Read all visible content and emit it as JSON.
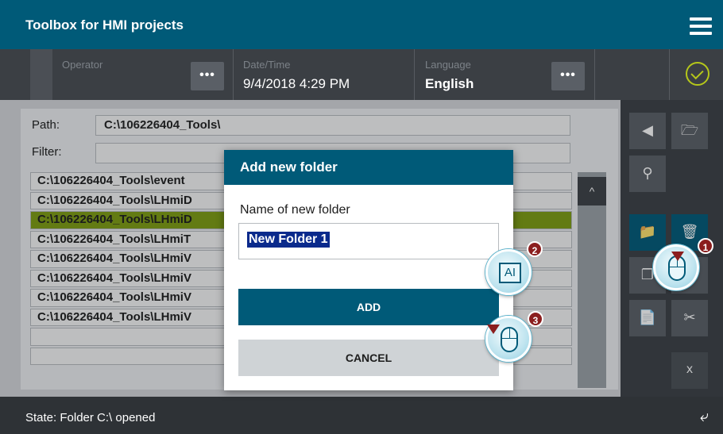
{
  "app": {
    "title": "Toolbox for HMI projects"
  },
  "infobar": {
    "operator_label": "Operator",
    "datetime_label": "Date/Time",
    "datetime_value": "9/4/2018 4:29 PM",
    "language_label": "Language",
    "language_value": "English",
    "more_label": "•••"
  },
  "browser": {
    "path_label": "Path:",
    "path_value": "C:\\106226404_Tools\\",
    "filter_label": "Filter:",
    "filter_value": "",
    "rows": [
      "C:\\106226404_Tools\\event",
      "C:\\106226404_Tools\\LHmiD",
      "C:\\106226404_Tools\\LHmiD",
      "C:\\106226404_Tools\\LHmiT",
      "C:\\106226404_Tools\\LHmiV",
      "C:\\106226404_Tools\\LHmiV",
      "C:\\106226404_Tools\\LHmiV",
      "C:\\106226404_Tools\\LHmiV",
      "",
      ""
    ],
    "selected_row_index": 2
  },
  "dialog": {
    "title": "Add new folder",
    "name_label": "Name of new folder",
    "name_value": "New Folder 1",
    "add_label": "ADD",
    "cancel_label": "CANCEL"
  },
  "toolbar": {
    "close_label": "x"
  },
  "status": {
    "text": "State: Folder C:\\ opened"
  },
  "callouts": [
    {
      "number": "1",
      "icon": "mouse-click-icon"
    },
    {
      "number": "2",
      "icon": "text-cursor-icon"
    },
    {
      "number": "3",
      "icon": "mouse-click-icon"
    }
  ],
  "colors": {
    "accent": "#005a78",
    "selected_row": "#7e9c10",
    "status_ok": "#b5c71a",
    "badge": "#8b1e1e"
  }
}
